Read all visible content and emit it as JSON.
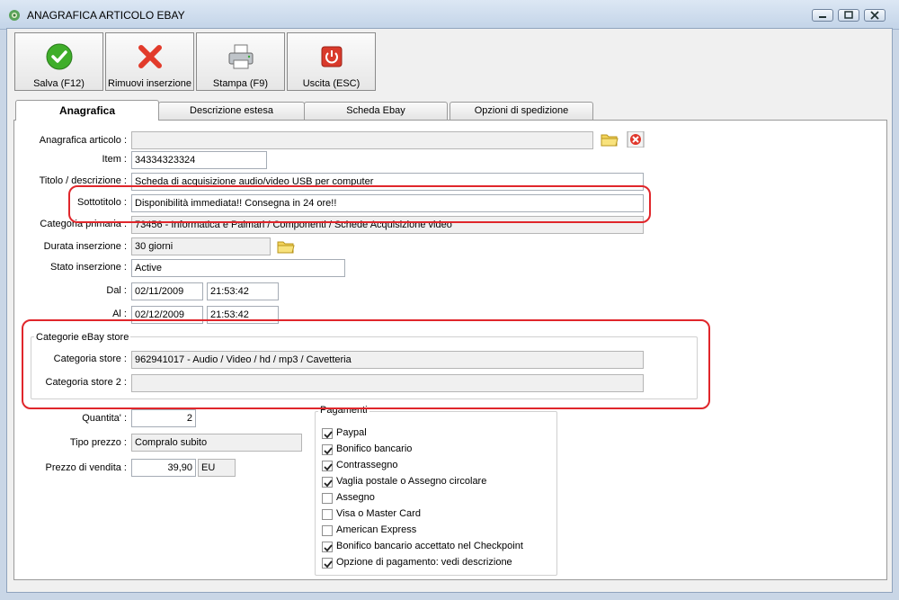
{
  "window": {
    "title": "ANAGRAFICA ARTICOLO EBAY"
  },
  "toolbar": {
    "save_label": "Salva (F12)",
    "remove_label": "Rimuovi inserzione",
    "print_label": "Stampa (F9)",
    "exit_label": "Uscita (ESC)"
  },
  "tabs": [
    "Anagrafica",
    "Descrizione estesa",
    "Scheda Ebay",
    "Opzioni di spedizione"
  ],
  "form": {
    "anagrafica_label": "Anagrafica articolo :",
    "anagrafica_value": "",
    "item_label": "Item :",
    "item_value": "34334323324",
    "titolo_label": "Titolo / descrizione :",
    "titolo_value": "Scheda di acquisizione audio/video USB per computer",
    "sottotitolo_label": "Sottotitolo :",
    "sottotitolo_value": "Disponibilità immediata!! Consegna in 24 ore!!",
    "categoria_label": "Categoria primaria :",
    "categoria_value": "73456 - Informatica e Palmari / Componenti / Schede Acquisizione video",
    "durata_label": "Durata inserzione :",
    "durata_value": "30 giorni",
    "stato_label": "Stato inserzione :",
    "stato_value": "Active",
    "dal_label": "Dal :",
    "dal_date": "02/11/2009",
    "dal_time": "21:53:42",
    "al_label": "Al :",
    "al_date": "02/12/2009",
    "al_time": "21:53:42"
  },
  "store": {
    "group_title": "Categorie eBay store",
    "cat1_label": "Categoria store :",
    "cat1_value": "962941017 - Audio / Video / hd / mp3 / Cavetteria",
    "cat2_label": "Categoria store 2 :",
    "cat2_value": ""
  },
  "prezzo": {
    "quantita_label": "Quantita' :",
    "quantita_value": "2",
    "tipo_label": "Tipo prezzo :",
    "tipo_value": "Compralo subito",
    "prezzo_label": "Prezzo di vendita :",
    "prezzo_value": "39,90",
    "valuta": "EU"
  },
  "pagamenti": {
    "title": "Pagamenti",
    "items": [
      {
        "label": "Paypal",
        "checked": true
      },
      {
        "label": "Bonifico bancario",
        "checked": true
      },
      {
        "label": "Contrassegno",
        "checked": true
      },
      {
        "label": "Vaglia postale o Assegno circolare",
        "checked": true
      },
      {
        "label": "Assegno",
        "checked": false
      },
      {
        "label": "Visa o Master Card",
        "checked": false
      },
      {
        "label": "American Express",
        "checked": false
      },
      {
        "label": "Bonifico bancario accettato nel Checkpoint",
        "checked": true
      },
      {
        "label": "Opzione di pagamento: vedi descrizione",
        "checked": true
      }
    ]
  },
  "colors": {
    "highlight_ring": "#e0262b",
    "save_green": "#3fae2a",
    "remove_red": "#e23b2b",
    "exit_red": "#d93a2b"
  },
  "icons": [
    "app-icon",
    "check-icon",
    "remove-x-icon",
    "printer-icon",
    "power-exit-icon",
    "folder-icon",
    "clear-icon"
  ]
}
